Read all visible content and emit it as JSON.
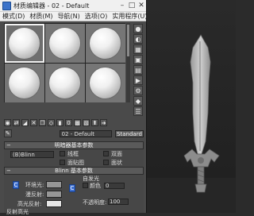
{
  "window": {
    "title": "材质编辑器 - 02 - Default"
  },
  "menu": {
    "items": [
      "模式(D)",
      "材质(M)",
      "导航(N)",
      "选项(O)",
      "实用程序(U)"
    ]
  },
  "material": {
    "name": "02 - Default",
    "type": "Standard"
  },
  "rollouts": {
    "shader_basic": "明暗器基本参数",
    "blinn_basic": "Blinn 基本参数"
  },
  "shader": {
    "selected": "(B)Blinn",
    "options": [
      "线框",
      "双面",
      "面贴图",
      "面状"
    ]
  },
  "blinn": {
    "self_illum_group": "自发光",
    "color_label": "颜色",
    "ambient_label": "环境光:",
    "diffuse_label": "漫反射:",
    "specular_label": "高光反射:",
    "opacity_label": "不透明度:",
    "opacity_value": "100",
    "self_illum_value": "0",
    "reflection_hilite": "反射高光"
  },
  "colors": {
    "ambient": "#969696",
    "diffuse": "#969696",
    "specular": "#e5e5e5",
    "accent": "#3d6fd0"
  }
}
